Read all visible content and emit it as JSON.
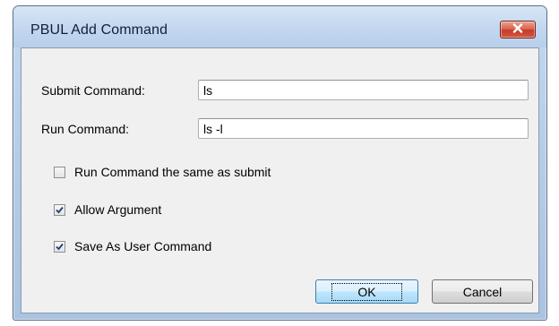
{
  "window": {
    "title": "PBUL Add Command",
    "close_icon": "close-icon"
  },
  "form": {
    "submit_label": "Submit Command:",
    "submit_value": "ls",
    "run_label": "Run Command:",
    "run_value": "ls -l"
  },
  "options": [
    {
      "label": "Run Command the same as submit",
      "checked": false
    },
    {
      "label": "Allow Argument",
      "checked": true
    },
    {
      "label": "Save As User Command",
      "checked": true
    }
  ],
  "buttons": {
    "ok_label": "OK",
    "cancel_label": "Cancel"
  },
  "colors": {
    "close_button": "#c8392a",
    "default_button_border": "#3c7fb1",
    "check_mark": "#1f3d7a"
  }
}
